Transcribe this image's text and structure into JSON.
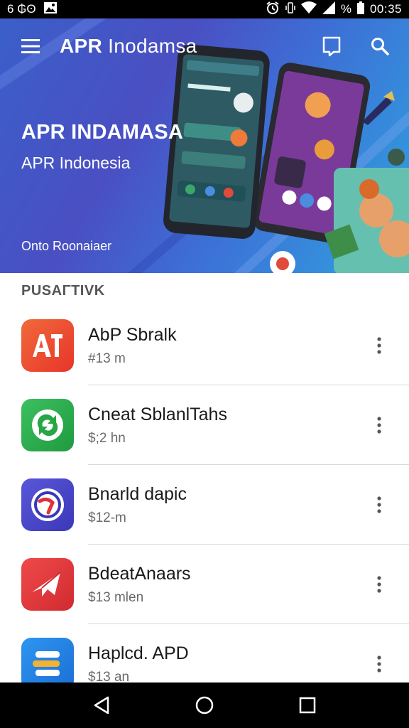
{
  "status_bar": {
    "left_text": "6 ₲ʘ",
    "battery_text": "%",
    "clock": "00:35",
    "icons": [
      "image-icon",
      "alarm-icon",
      "vibrate-icon",
      "wifi-icon",
      "signal-icon",
      "battery-icon"
    ]
  },
  "toolbar": {
    "title_bold": "APR",
    "title_rest": "Inodamsa",
    "icons": [
      "menu-icon",
      "bookmark-icon",
      "search-icon"
    ]
  },
  "hero": {
    "headline": "APR INDAMASA",
    "subtitle": "APR Indonesia",
    "footer": "Onto Roonaiaer"
  },
  "section": {
    "label": "PUSAΓΤΙVK"
  },
  "apps": [
    {
      "name": "AbP Sbralk",
      "price": "#13 m",
      "icon": "ap-logo-icon",
      "color": "#e8452c"
    },
    {
      "name": "Cneat SblanlTahs",
      "price": "$;2 hn",
      "icon": "refresh-arrows-icon",
      "color": "#27a645"
    },
    {
      "name": "Bnarld dapic",
      "price": "$12-m",
      "icon": "circle-swirl-icon",
      "color": "#4a49c9"
    },
    {
      "name": "BdeatAnaars",
      "price": "$13 mlen",
      "icon": "paper-plane-icon",
      "color": "#e0323a"
    },
    {
      "name": "Haplcd. APD",
      "price": "$13 an",
      "icon": "stacked-bars-icon",
      "color": "#1f80e3"
    }
  ],
  "nav": {
    "icons": [
      "back-icon",
      "home-icon",
      "recents-icon"
    ]
  }
}
